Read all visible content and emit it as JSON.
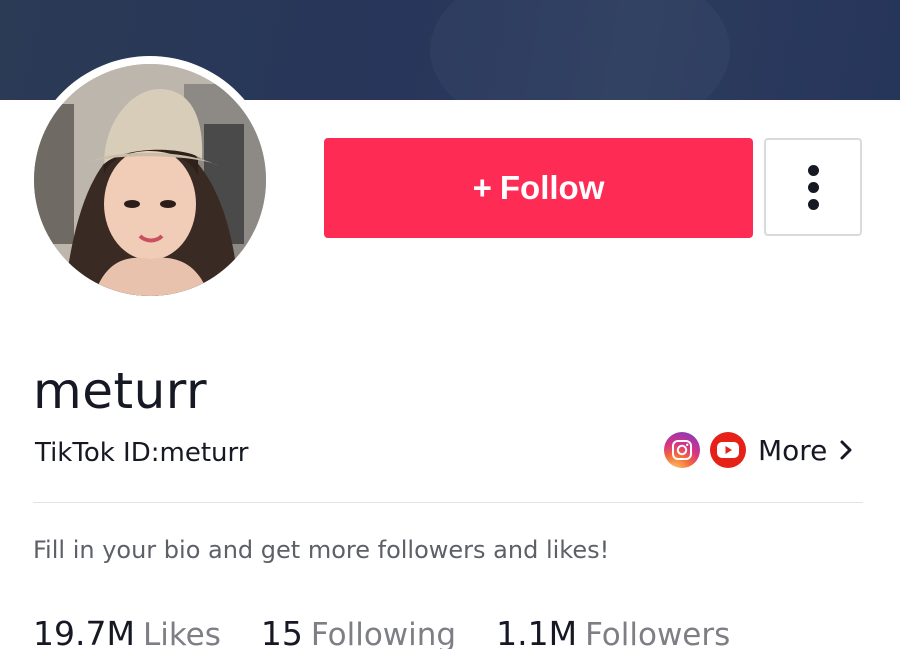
{
  "header": {
    "cover_color": "#2b3a55"
  },
  "profile": {
    "username": "meturr",
    "tiktok_id": "TikTok ID:meturr",
    "bio": "Fill in your bio and get more followers and likes!"
  },
  "actions": {
    "follow_plus": "+",
    "follow_label": "Follow",
    "follow_color": "#fe2c55"
  },
  "social": {
    "icons": [
      "instagram-icon",
      "youtube-icon",
      "chevron-right-icon"
    ],
    "more_label": "More"
  },
  "stats": [
    {
      "value": "19.7M",
      "label": "Likes"
    },
    {
      "value": "15",
      "label": "Following"
    },
    {
      "value": "1.1M",
      "label": "Followers"
    }
  ]
}
